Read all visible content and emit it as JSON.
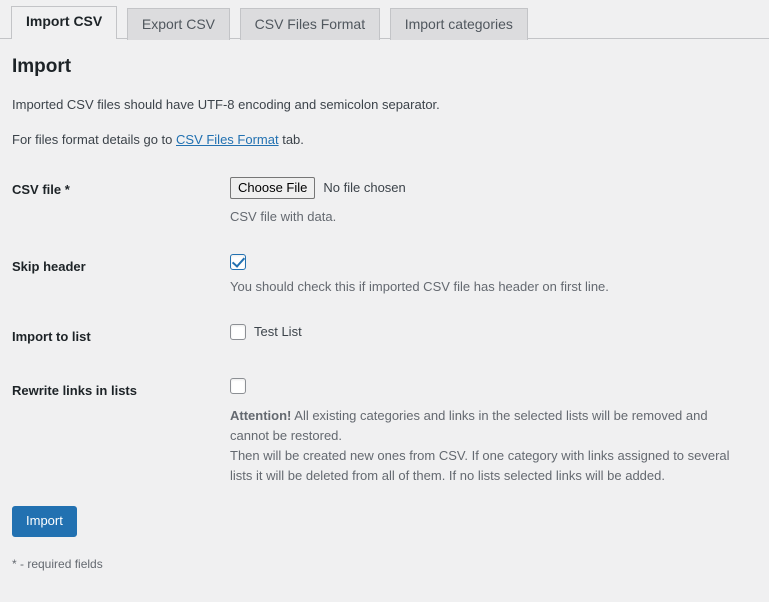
{
  "tabs": [
    {
      "label": "Import CSV",
      "active": true
    },
    {
      "label": "Export CSV",
      "active": false
    },
    {
      "label": "CSV Files Format",
      "active": false
    },
    {
      "label": "Import categories",
      "active": false
    }
  ],
  "page": {
    "heading": "Import",
    "intro_1": "Imported CSV files should have UTF-8 encoding and semicolon separator.",
    "intro_2_prefix": "For files format details go to ",
    "intro_2_link": "CSV Files Format",
    "intro_2_suffix": " tab."
  },
  "fields": {
    "csv_file": {
      "label": "CSV file *",
      "button_label": "Choose File",
      "file_status": "No file chosen",
      "description": "CSV file with data."
    },
    "skip_header": {
      "label": "Skip header",
      "checked": true,
      "description": "You should check this if imported CSV file has header on first line."
    },
    "import_to_list": {
      "label": "Import to list",
      "options": [
        {
          "label": "Test List",
          "checked": false
        }
      ]
    },
    "rewrite_links": {
      "label": "Rewrite links in lists",
      "checked": false,
      "warning_strong": "Attention!",
      "warning_line_1": " All existing categories and links in the selected lists will be removed and cannot be restored.",
      "warning_line_2": "Then will be created new ones from CSV. If one category with links assigned to several lists it will be deleted from all of them. If no lists selected links will be added."
    }
  },
  "submit": {
    "label": "Import"
  },
  "footer": {
    "required_note": "* - required fields"
  },
  "colors": {
    "accent": "#2271b1",
    "page_background": "#f0f0f1",
    "tab_inactive": "#dcdcde",
    "border": "#c3c4c7",
    "text": "#3c434a",
    "muted_text": "#646970",
    "heading_text": "#1d2327"
  }
}
